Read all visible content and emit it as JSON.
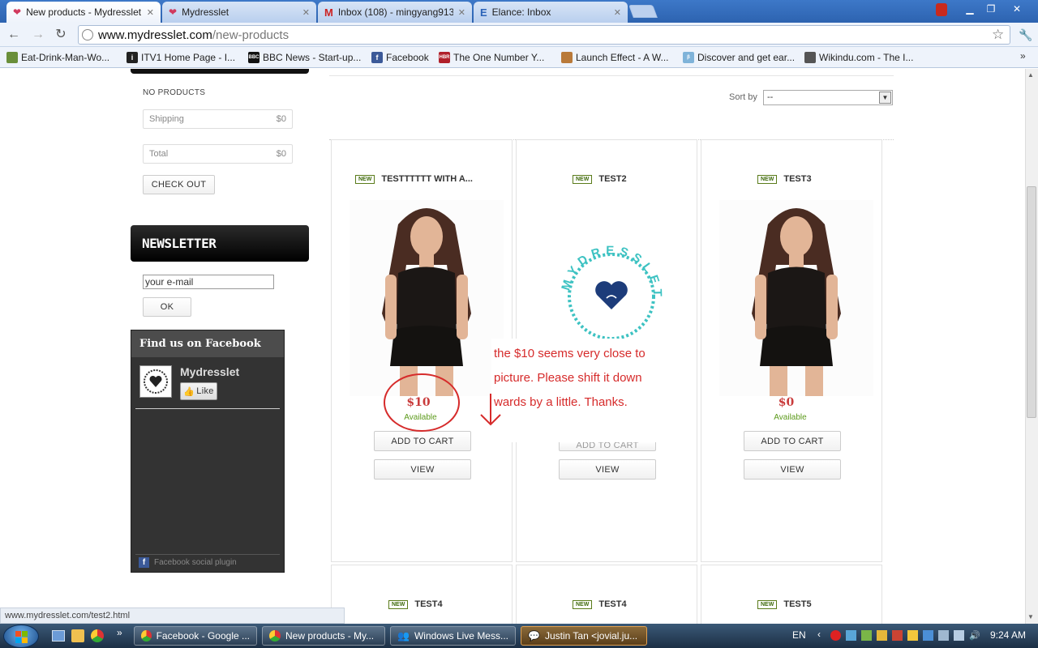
{
  "browser": {
    "tabs": [
      {
        "title": "New products - Mydresslet",
        "active": true
      },
      {
        "title": "Mydresslet",
        "active": false
      },
      {
        "title": "Inbox (108) - mingyang913",
        "active": false
      },
      {
        "title": "Elance: Inbox",
        "active": false
      }
    ],
    "url_host": "www.mydresslet.com",
    "url_path": "/new-products",
    "bookmarks": [
      {
        "label": "Eat-Drink-Man-Wo...",
        "icon": "bookmark-icon"
      },
      {
        "label": "ITV1 Home Page - I...",
        "icon": "itv-icon"
      },
      {
        "label": "BBC News - Start-up...",
        "icon": "bbc-icon"
      },
      {
        "label": "Facebook",
        "icon": "facebook-icon"
      },
      {
        "label": "The One Number Y...",
        "icon": "hbr-icon"
      },
      {
        "label": "Launch Effect - A W...",
        "icon": "bookmark-icon"
      },
      {
        "label": "Discover and get ear...",
        "icon": "beta-icon"
      },
      {
        "label": "Wikindu.com - The I...",
        "icon": "bookmark-icon"
      }
    ],
    "status_url": "www.mydresslet.com/test2.html"
  },
  "cart": {
    "empty_text": "NO PRODUCTS",
    "shipping_label": "Shipping",
    "shipping_value": "$0",
    "total_label": "Total",
    "total_value": "$0",
    "checkout_label": "CHECK OUT"
  },
  "sort": {
    "label": "Sort by",
    "selected": "--"
  },
  "newsletter": {
    "title": "NEWSLETTER",
    "placeholder": "your e-mail",
    "ok_label": "OK"
  },
  "facebook": {
    "header": "Find us on Facebook",
    "page_name": "Mydresslet",
    "like_label": "Like",
    "plugin_label": "Facebook social plugin"
  },
  "products": [
    {
      "badge": "NEW",
      "name": "TESTTTTTT WITH A...",
      "price": "$10",
      "availability": "Available",
      "add_label": "ADD TO CART",
      "view_label": "VIEW",
      "image": "model"
    },
    {
      "badge": "NEW",
      "name": "TEST2",
      "price": "",
      "availability": "",
      "add_label": "ADD TO CART",
      "view_label": "VIEW",
      "image": "logo"
    },
    {
      "badge": "NEW",
      "name": "TEST3",
      "price": "$0",
      "availability": "Available",
      "add_label": "ADD TO CART",
      "view_label": "VIEW",
      "image": "model"
    }
  ],
  "products_row2": [
    {
      "badge": "NEW",
      "name": "TEST4"
    },
    {
      "badge": "NEW",
      "name": "TEST4"
    },
    {
      "badge": "NEW",
      "name": "TEST5"
    }
  ],
  "annotation": {
    "lines": [
      "the $10 seems very close to",
      "picture. Please shift it down",
      "wards by a little. Thanks."
    ],
    "color": "#d62b2b"
  },
  "logo_text": "MYDRESSLET",
  "taskbar": {
    "items": [
      {
        "label": "Facebook - Google ...",
        "active": false
      },
      {
        "label": "New products - My...",
        "active": false
      },
      {
        "label": "Windows Live Mess...",
        "active": false
      },
      {
        "label": "Justin Tan <jovial.ju...",
        "active": true
      }
    ],
    "language": "EN",
    "time": "9:24 AM"
  }
}
